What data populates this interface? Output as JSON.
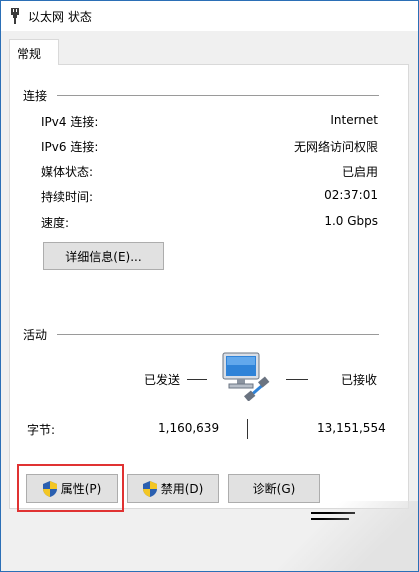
{
  "window": {
    "title": "以太网 状态",
    "accent": "#2b6fb6"
  },
  "tabs": [
    {
      "label": "常规",
      "selected": true
    }
  ],
  "connection": {
    "section_label": "连接",
    "rows": [
      {
        "label": "IPv4 连接:",
        "value": "Internet"
      },
      {
        "label": "IPv6 连接:",
        "value": "无网络访问权限"
      },
      {
        "label": "媒体状态:",
        "value": "已启用"
      },
      {
        "label": "持续时间:",
        "value": "02:37:01"
      },
      {
        "label": "速度:",
        "value": "1.0 Gbps"
      }
    ],
    "details_button": "详细信息(E)..."
  },
  "activity": {
    "section_label": "活动",
    "sent_label": "已发送",
    "received_label": "已接收",
    "bytes_label": "字节:",
    "bytes_sent": "1,160,639",
    "bytes_received": "13,151,554"
  },
  "buttons": {
    "properties": "属性(P)",
    "disable": "禁用(D)",
    "diagnose": "诊断(G)"
  },
  "icons": {
    "title": "ethernet-plug-icon",
    "network": "network-computer-icon",
    "shield": "uac-shield-icon"
  },
  "colors": {
    "highlight": "#e03232",
    "button_bg": "#e1e1e1"
  }
}
